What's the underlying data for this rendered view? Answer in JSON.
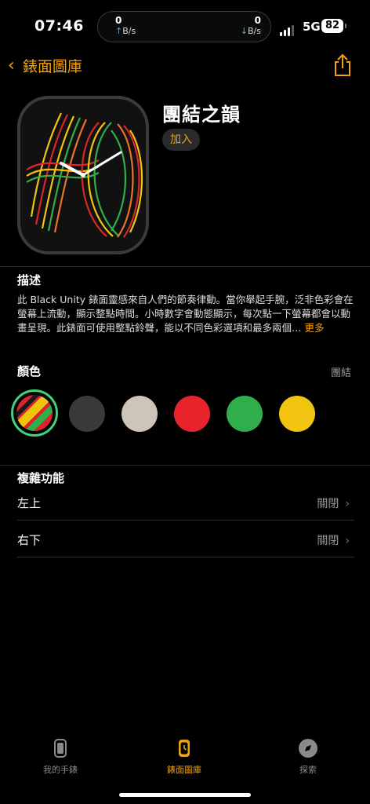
{
  "status": {
    "time": "07:46",
    "net_up_value": "0",
    "net_up_unit": "B/s",
    "net_down_value": "0",
    "net_down_unit": "B/s",
    "network": "5G",
    "battery": "82"
  },
  "nav": {
    "back_label": "錶面圖庫"
  },
  "face": {
    "title": "團結之韻",
    "add_label": "加入"
  },
  "description": {
    "heading": "描述",
    "text": "此 Black Unity 錶面靈感來自人們的節奏律動。當你舉起手腕，泛非色彩會在螢幕上流動，顯示整點時間。小時數字會動態顯示，每次點一下螢幕都會以動畫呈現。此錶面可使用整點鈴聲，能以不同色彩選項和最多兩個…",
    "more_label": "更多"
  },
  "colors": {
    "heading": "顏色",
    "selected": "團結",
    "swatches": [
      "#d9262a",
      "#3a3a3a",
      "#cfc4b8",
      "#e8232b",
      "#2fae4b",
      "#f1c40f"
    ]
  },
  "complications": {
    "heading": "複雜功能",
    "rows": [
      {
        "label": "左上",
        "value": "關閉"
      },
      {
        "label": "右下",
        "value": "關閉"
      }
    ]
  },
  "tabbar": {
    "items": [
      {
        "label": "我的手錶",
        "icon": "watch-icon"
      },
      {
        "label": "錶面圖庫",
        "icon": "watch-face-icon"
      },
      {
        "label": "探索",
        "icon": "compass-icon"
      }
    ],
    "active_index": 1
  },
  "accent": "#f0a30a"
}
